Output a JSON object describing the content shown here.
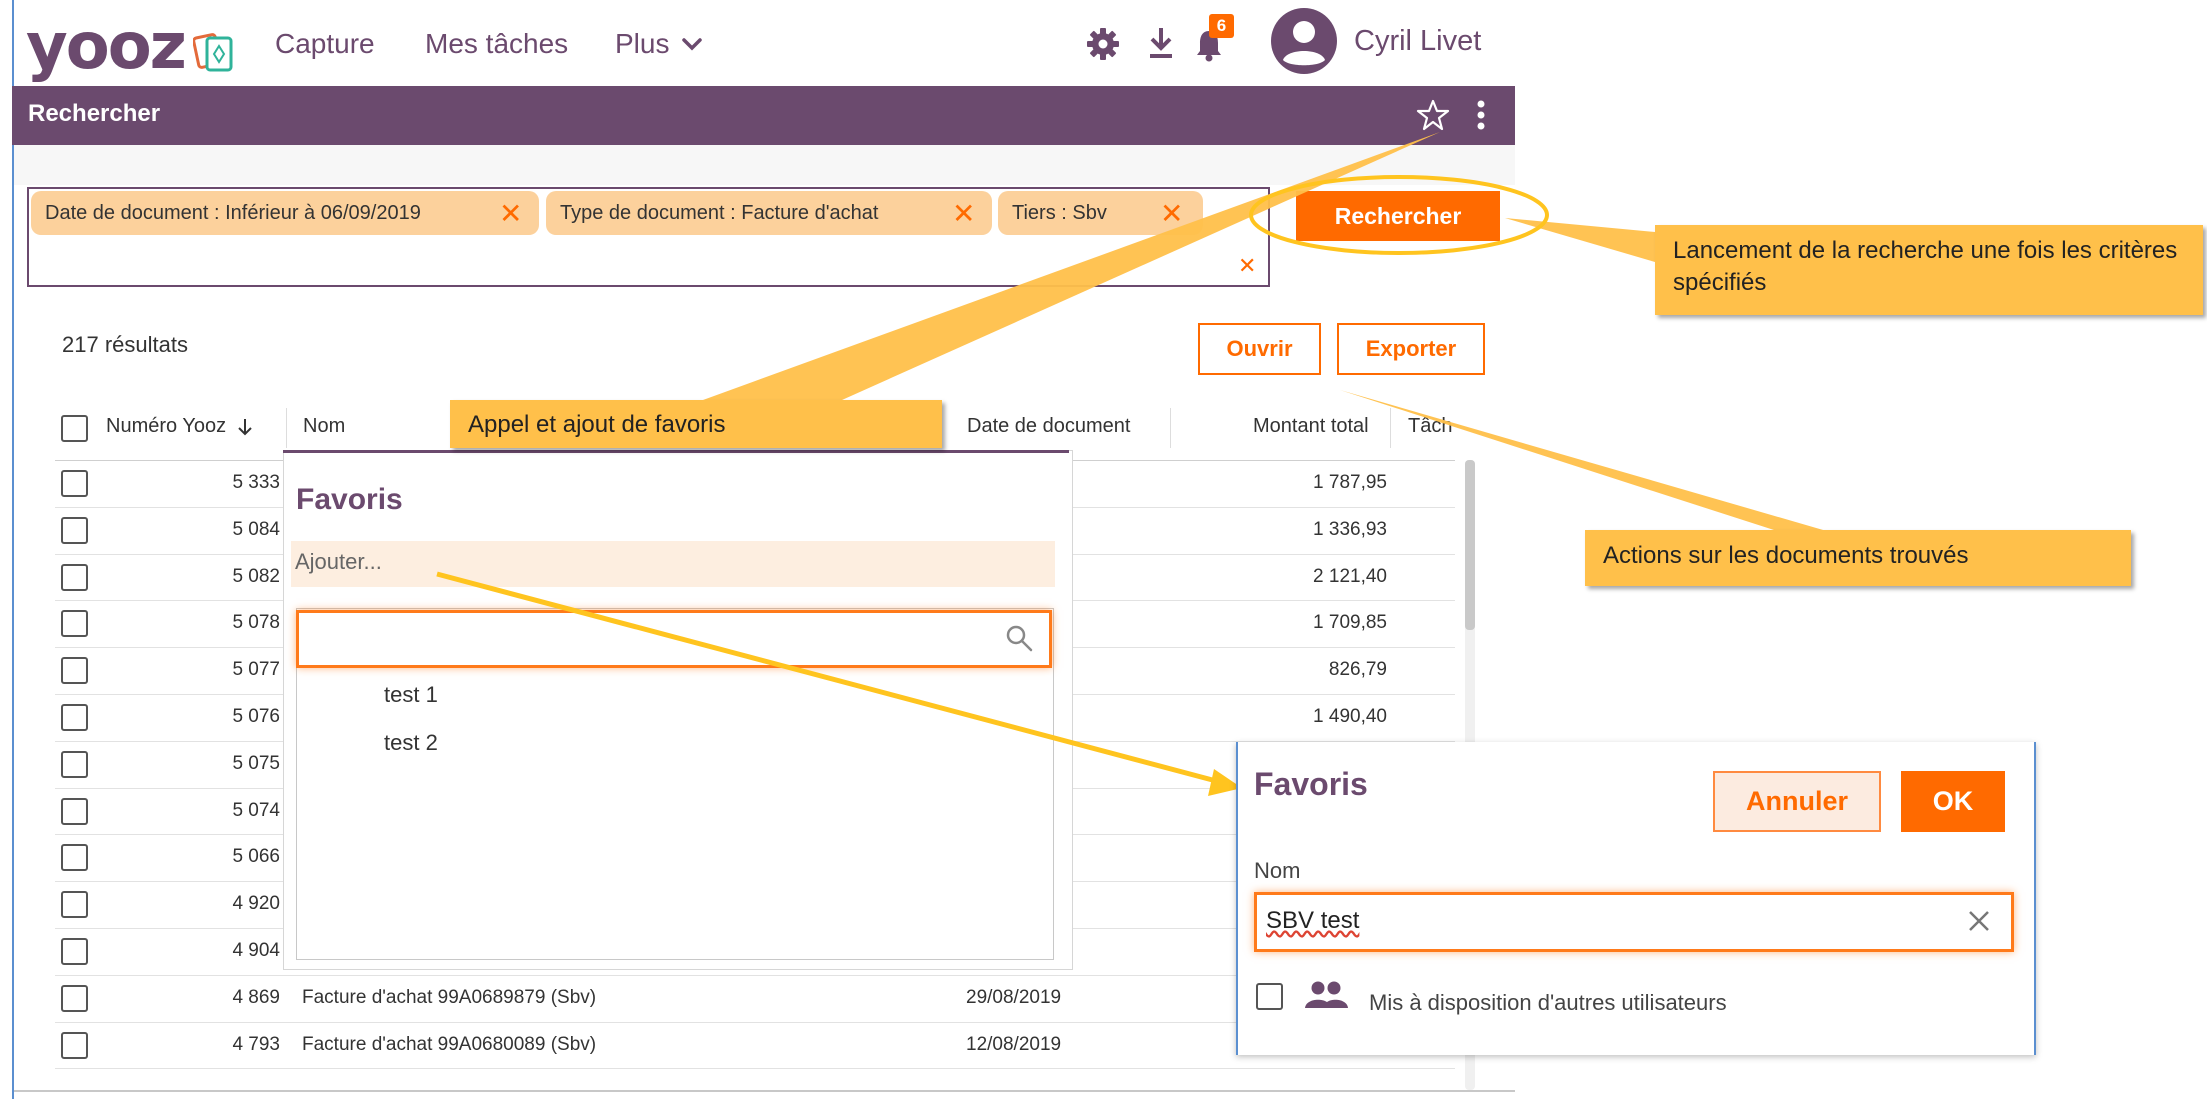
{
  "header": {
    "logo_text": "yooz",
    "nav": [
      "Capture",
      "Mes tâches",
      "Plus"
    ],
    "notification_count": "6",
    "user_name": "Cyril Livet"
  },
  "page_title": "Rechercher",
  "search": {
    "chips": [
      "Date de document : Inférieur à 06/09/2019",
      "Type de document : Facture d'achat",
      "Tiers : Sbv"
    ],
    "button": "Rechercher"
  },
  "results": {
    "count_text": "217 résultats",
    "open_button": "Ouvrir",
    "export_button": "Exporter"
  },
  "table": {
    "columns": [
      "Numéro Yooz",
      "Nom",
      "Date de document",
      "Montant total",
      "Tâch"
    ],
    "rows": [
      {
        "num": "5 333",
        "nom": "",
        "date": "",
        "amount": "1 787,95"
      },
      {
        "num": "5 084",
        "nom": "",
        "date": "",
        "amount": "1 336,93"
      },
      {
        "num": "5 082",
        "nom": "",
        "date": "",
        "amount": "2 121,40"
      },
      {
        "num": "5 078",
        "nom": "",
        "date": "",
        "amount": "1 709,85"
      },
      {
        "num": "5 077",
        "nom": "",
        "date": "",
        "amount": "826,79"
      },
      {
        "num": "5 076",
        "nom": "",
        "date": "",
        "amount": "1 490,40"
      },
      {
        "num": "5 075",
        "nom": "",
        "date": "",
        "amount": ""
      },
      {
        "num": "5 074",
        "nom": "",
        "date": "",
        "amount": ""
      },
      {
        "num": "5 066",
        "nom": "",
        "date": "",
        "amount": ""
      },
      {
        "num": "4 920",
        "nom": "",
        "date": "",
        "amount": ""
      },
      {
        "num": "4 904",
        "nom": "",
        "date": "",
        "amount": ""
      },
      {
        "num": "4 869",
        "nom": "Facture d'achat 99A0689879 (Sbv)",
        "date": "29/08/2019",
        "amount": ""
      },
      {
        "num": "4 793",
        "nom": "Facture d'achat 99A0680089 (Sbv)",
        "date": "12/08/2019",
        "amount": ""
      }
    ]
  },
  "favoris_panel": {
    "title": "Favoris",
    "add_label": "Ajouter...",
    "search_value": "",
    "items": [
      "test 1",
      "test 2"
    ]
  },
  "favoris_dialog": {
    "title": "Favoris",
    "cancel_button": "Annuler",
    "ok_button": "OK",
    "name_label": "Nom",
    "name_value": "SBV test",
    "share_label": "Mis à disposition d'autres utilisateurs"
  },
  "callouts": {
    "search_launch": "Lancement de la recherche une fois les critères spécifiés",
    "favorites": "Appel et ajout de favoris",
    "actions": "Actions sur les documents trouvés"
  },
  "colors": {
    "brand_purple": "#6b4a6e",
    "accent_orange": "#ff6a00",
    "chip_bg": "#fcd19c",
    "callout_bg": "#ffc04a",
    "annotation_line": "#ffc41f"
  }
}
